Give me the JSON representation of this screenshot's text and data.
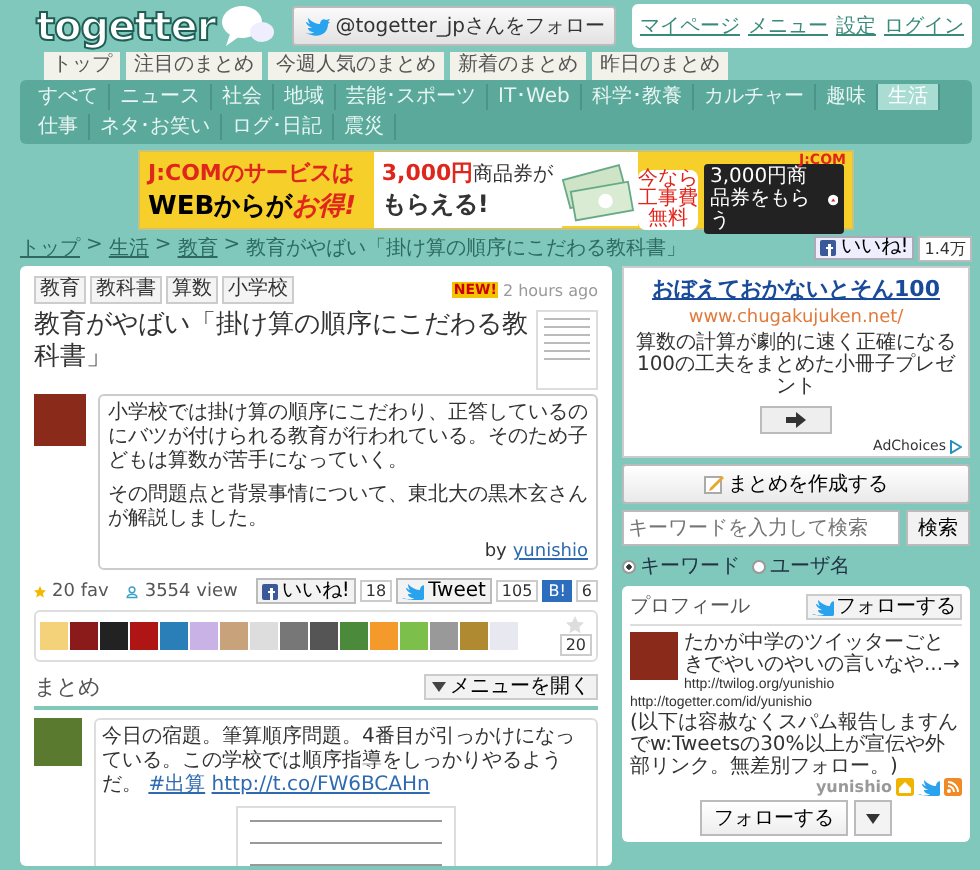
{
  "header": {
    "logo": "togetter",
    "follow_button": "@togetter_jpさんをフォロー",
    "links": [
      "マイページ",
      "メニュー",
      "設定",
      "ログイン"
    ]
  },
  "tabs": [
    {
      "label": "トップ",
      "selected": false
    },
    {
      "label": "注目のまとめ",
      "selected": false
    },
    {
      "label": "今週人気のまとめ",
      "selected": false
    },
    {
      "label": "新着のまとめ",
      "selected": false
    },
    {
      "label": "昨日のまとめ",
      "selected": false
    }
  ],
  "categories": [
    {
      "label": "すべて",
      "selected": false
    },
    {
      "label": "ニュース",
      "selected": false
    },
    {
      "label": "社会",
      "selected": false
    },
    {
      "label": "地域",
      "selected": false
    },
    {
      "label": "芸能･スポーツ",
      "selected": false
    },
    {
      "label": "IT･Web",
      "selected": false
    },
    {
      "label": "科学･教養",
      "selected": false
    },
    {
      "label": "カルチャー",
      "selected": false
    },
    {
      "label": "趣味",
      "selected": false
    },
    {
      "label": "生活",
      "selected": true
    },
    {
      "label": "仕事",
      "selected": false
    },
    {
      "label": "ネタ･お笑い",
      "selected": false
    },
    {
      "label": "ログ･日記",
      "selected": false
    },
    {
      "label": "震災",
      "selected": false
    }
  ],
  "ad_banner": {
    "headline_1": "J:COMのサービスは",
    "headline_2": "WEBからが",
    "headline_accent": "お得!",
    "offer_amount": "3,000円",
    "offer_rest": "商品券が",
    "offer_2": "もらえる!",
    "badge": "今なら工事費無料",
    "button": "3,000円商品券をもらう",
    "brand": "J:COM"
  },
  "breadcrumb": {
    "separator": ">",
    "items": [
      "トップ",
      "生活",
      "教育"
    ],
    "current": "教育がやばい「掛け算の順序にこだわる教科書」"
  },
  "page_like": {
    "label": "いいね!",
    "count": "1.4万"
  },
  "article": {
    "tags": [
      "教育",
      "教科書",
      "算数",
      "小学校"
    ],
    "new_badge": "NEW!",
    "time": "2 hours ago",
    "title": "教育がやばい「掛け算の順序にこだわる教科書」",
    "description": [
      "小学校では掛け算の順序にこだわり、正答しているのにバツが付けられる教育が行われている。そのため子どもは算数が苦手になっていく。",
      "その問題点と背景事情について、東北大の黒木玄さんが解説しました。"
    ],
    "by": "by",
    "author": "yunishio",
    "fav": "20 fav",
    "views": "3554 view",
    "like": {
      "label": "いいね!",
      "count": "18"
    },
    "tweet": {
      "label": "Tweet",
      "count": "105"
    },
    "hatena": {
      "label": "B!",
      "count": "6"
    },
    "fav_count": "20"
  },
  "summary": {
    "title": "まとめ",
    "menu_button": "メニューを開く",
    "tweets": [
      {
        "text": "今日の宿題。筆算順序問題。4番目が引っかけになっている。この学校では順序指導をしっかりやるようだ。",
        "hashtag": "#出算",
        "link": "http://t.co/FW6BCAHn"
      }
    ]
  },
  "side_ad": {
    "title": "おぼえておかないとそん100",
    "url": "www.chugakujuken.net/",
    "text": "算数の計算が劇的に速く正確になる 100の工夫をまとめた小冊子プレゼント",
    "adchoices": "AdChoices"
  },
  "create_button": "まとめを作成する",
  "search": {
    "placeholder": "キーワードを入力して検索",
    "button": "検索",
    "options": [
      {
        "label": "キーワード",
        "selected": true
      },
      {
        "label": "ユーザ名",
        "selected": false
      }
    ]
  },
  "profile": {
    "title": "プロフィール",
    "follow_small": "フォローする",
    "bio": [
      {
        "kind": "text",
        "text": "たかが中学のツイッターごときでやいのやいの言いなや...→"
      },
      {
        "kind": "url",
        "text": "http://twilog.org/yunishio"
      },
      {
        "kind": "url",
        "text": "http://togetter.com/id/yunishio"
      },
      {
        "kind": "text",
        "text": "(以下は容赦なくスパム報告しますんでw:Tweetsの30%以上が宣伝や外部リンク。無差別フォロー。)"
      }
    ],
    "name": "yunishio",
    "follow_button": "フォローする"
  }
}
